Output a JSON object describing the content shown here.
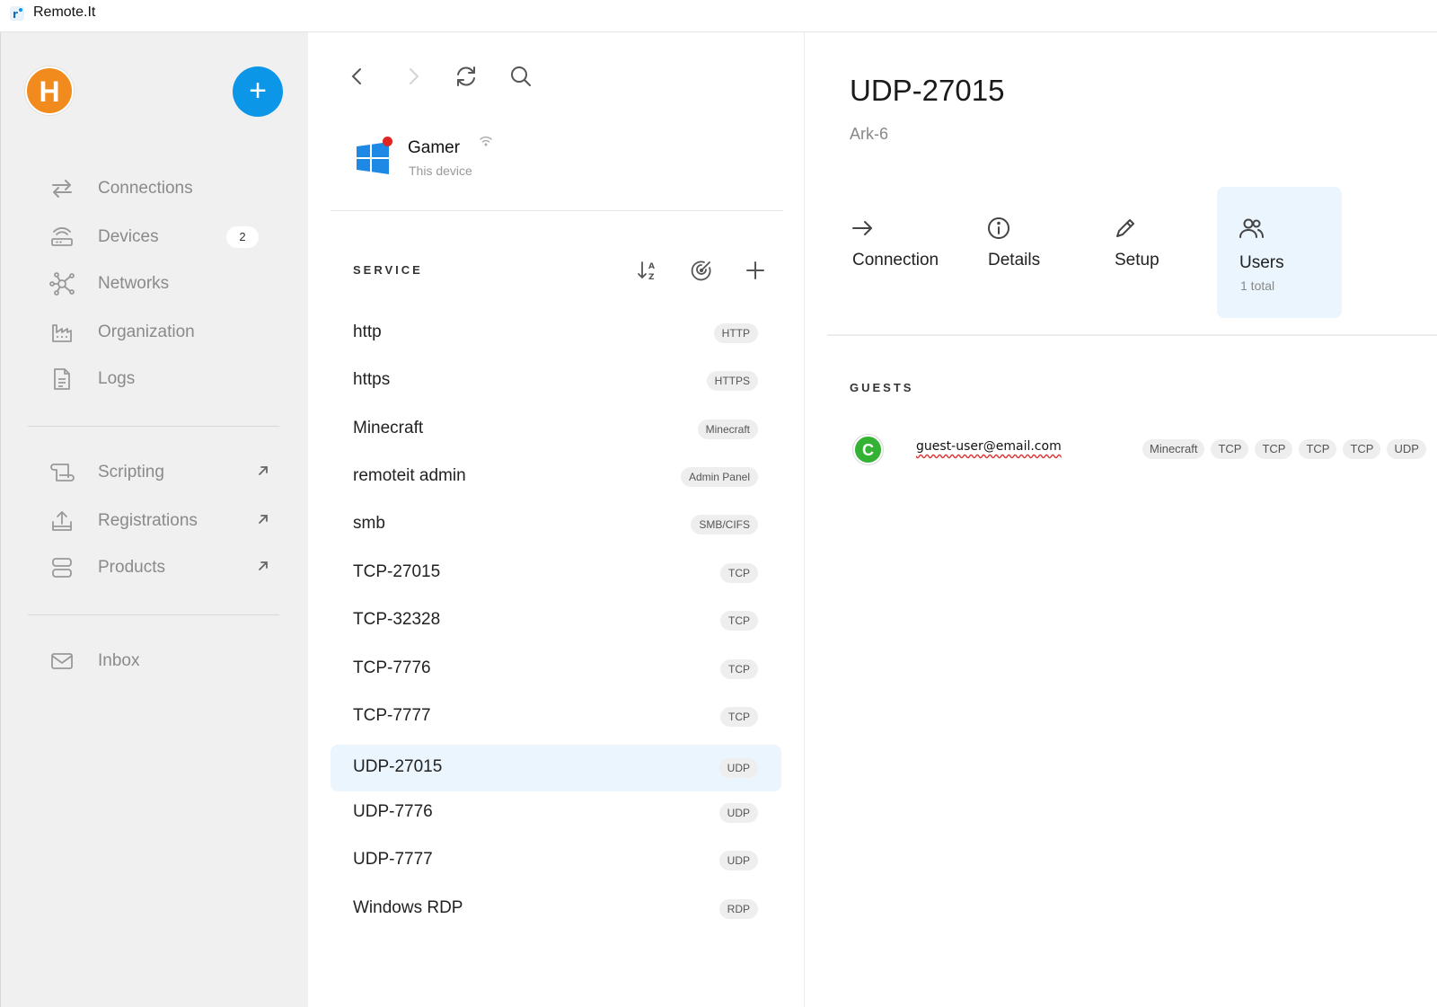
{
  "window": {
    "title": "Remote.It"
  },
  "sidebar": {
    "avatar_letter": "H",
    "add_label": "+",
    "items": [
      {
        "label": "Connections",
        "icon": "arrows-swap-icon"
      },
      {
        "label": "Devices",
        "icon": "router-icon",
        "badge": "2"
      },
      {
        "label": "Networks",
        "icon": "network-nodes-icon"
      },
      {
        "label": "Organization",
        "icon": "factory-icon"
      },
      {
        "label": "Logs",
        "icon": "document-icon"
      },
      {
        "label": "Scripting",
        "icon": "scroll-icon",
        "external": true
      },
      {
        "label": "Registrations",
        "icon": "upload-tray-icon",
        "external": true
      },
      {
        "label": "Products",
        "icon": "server-stack-icon",
        "external": true
      },
      {
        "label": "Inbox",
        "icon": "mail-icon"
      }
    ]
  },
  "middle": {
    "device": {
      "name": "Gamer",
      "subtitle": "This device",
      "icon": "windows-logo-icon",
      "status_color": "#e02424"
    },
    "section_label": "SERVICE",
    "services": [
      {
        "name": "http",
        "tag": "HTTP"
      },
      {
        "name": "https",
        "tag": "HTTPS"
      },
      {
        "name": "Minecraft",
        "tag": "Minecraft"
      },
      {
        "name": "remoteit admin",
        "tag": "Admin Panel"
      },
      {
        "name": "smb",
        "tag": "SMB/CIFS"
      },
      {
        "name": "TCP-27015",
        "tag": "TCP"
      },
      {
        "name": "TCP-32328",
        "tag": "TCP"
      },
      {
        "name": "TCP-7776",
        "tag": "TCP"
      },
      {
        "name": "TCP-7777",
        "tag": "TCP"
      },
      {
        "name": "UDP-27015",
        "tag": "UDP",
        "selected": true
      },
      {
        "name": "UDP-7776",
        "tag": "UDP"
      },
      {
        "name": "UDP-7777",
        "tag": "UDP"
      },
      {
        "name": "Windows RDP",
        "tag": "RDP"
      }
    ]
  },
  "detail": {
    "title": "UDP-27015",
    "subtitle": "Ark-6",
    "tabs": [
      {
        "label": "Connection",
        "icon": "arrow-right-icon"
      },
      {
        "label": "Details",
        "icon": "info-icon"
      },
      {
        "label": "Setup",
        "icon": "pencil-icon"
      },
      {
        "label": "Users",
        "icon": "users-icon",
        "sub": "1 total",
        "active": true
      }
    ],
    "guests_label": "GUESTS",
    "guest": {
      "avatar_letter": "C",
      "email": "guest-user@email.com",
      "tags": [
        "Minecraft",
        "TCP",
        "TCP",
        "TCP",
        "TCP",
        "UDP"
      ]
    }
  },
  "colors": {
    "accent": "#0b96e8",
    "avatar": "#f28b1d",
    "guest_avatar": "#34b234",
    "selected_bg": "#eaf5fd"
  }
}
